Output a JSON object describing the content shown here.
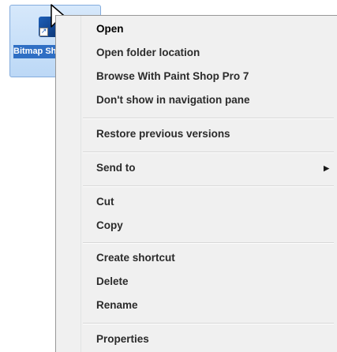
{
  "desktop_icon": {
    "label": "Bitmap Shop",
    "selected": true,
    "icon": "shortcut-icon"
  },
  "cursor": {
    "icon": "arrow-cursor-icon"
  },
  "context_menu": {
    "items": [
      {
        "label": "Open",
        "default": true
      },
      {
        "label": "Open folder location"
      },
      {
        "label": "Browse With Paint Shop Pro 7"
      },
      {
        "label": "Don't show in navigation pane"
      },
      {
        "label": "Restore previous versions"
      },
      {
        "label": "Send to",
        "has_submenu": true,
        "submenu_icon": "chevron-right-icon"
      },
      {
        "label": "Cut"
      },
      {
        "label": "Copy"
      },
      {
        "label": "Create shortcut"
      },
      {
        "label": "Delete"
      },
      {
        "label": "Rename"
      },
      {
        "label": "Properties"
      }
    ]
  },
  "colors": {
    "menu_background": "#f0f0f0",
    "selection_label": "#2f6fc4",
    "icon_highlight": "#bcd8f6"
  }
}
